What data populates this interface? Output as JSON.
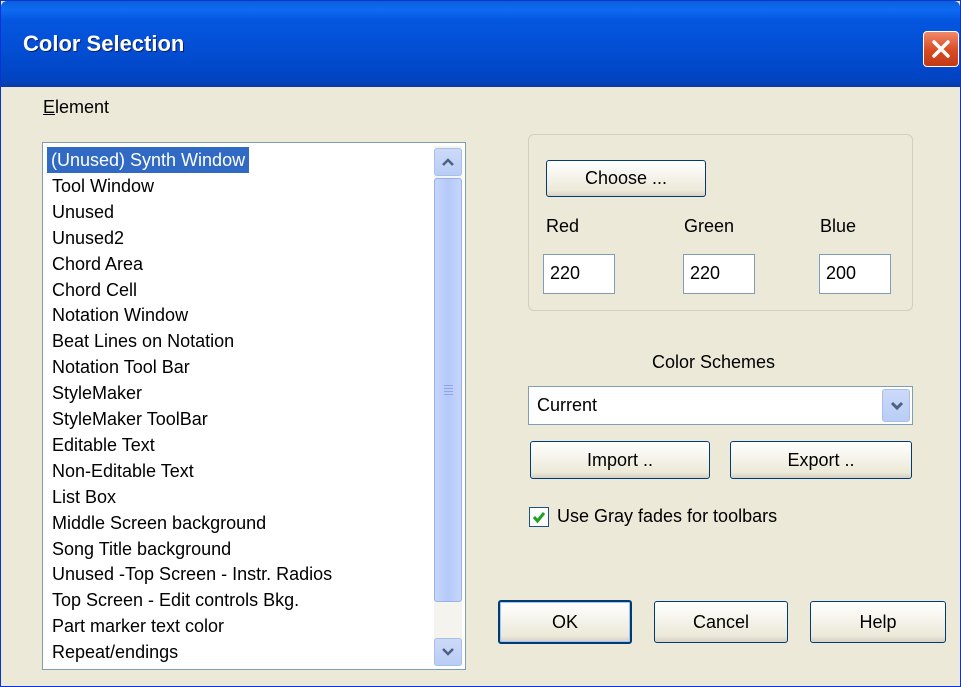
{
  "window": {
    "title": "Color Selection"
  },
  "element": {
    "label": "Element",
    "items": [
      "(Unused) Synth Window",
      "Tool Window",
      "Unused",
      "Unused2",
      "Chord Area",
      "Chord Cell",
      "Notation Window",
      "Beat Lines on Notation",
      "Notation Tool Bar",
      "StyleMaker",
      "StyleMaker ToolBar",
      "Editable Text",
      "Non-Editable Text",
      "List Box",
      "Middle Screen background",
      "Song Title background",
      "Unused -Top Screen - Instr. Radios",
      "Top Screen - Edit controls Bkg.",
      "Part marker text color",
      "Repeat/endings"
    ],
    "selected_index": 0
  },
  "color": {
    "choose_label": "Choose ...",
    "red_label": "Red",
    "green_label": "Green",
    "blue_label": "Blue",
    "red": "220",
    "green": "220",
    "blue": "200"
  },
  "schemes": {
    "label": "Color Schemes",
    "selected": "Current",
    "import_label": "Import ..",
    "export_label": "Export .."
  },
  "gray_fades": {
    "label": "Use Gray fades for toolbars",
    "checked": true
  },
  "buttons": {
    "ok": "OK",
    "cancel": "Cancel",
    "help": "Help"
  },
  "colors": {
    "title_bar": "#0350d6",
    "selection": "#316ac5",
    "dialog_bg": "#ece9d8",
    "check": "#21a121",
    "close": "#d84a22"
  },
  "icons": {
    "close": "close-icon",
    "scroll_up": "arrow-up-icon",
    "scroll_down": "arrow-down-icon",
    "combo": "chevron-down-icon",
    "check": "checkmark-icon"
  }
}
